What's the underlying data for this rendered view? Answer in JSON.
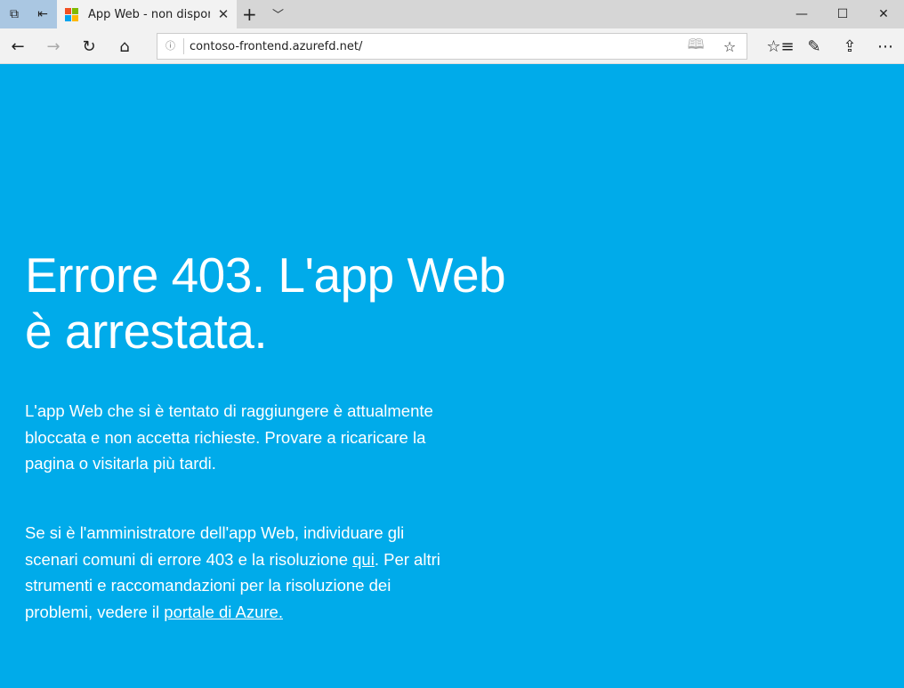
{
  "browser": {
    "tab_title": "App Web - non dispon",
    "url": "contoso-frontend.azurefd.net/",
    "brand_colors": [
      "#f25022",
      "#7fba00",
      "#00a4ef",
      "#ffb900"
    ]
  },
  "page": {
    "background": "#00abea",
    "heading_line1": "Errore 403. L'app Web",
    "heading_line2": "è arrestata.",
    "para1": "L'app Web che si è tentato di raggiungere è attualmente bloccata e non accetta richieste. Provare a ricaricare la pagina o visitarla più tardi.",
    "para2_a": "Se si è l'amministratore dell'app Web, individuare gli scenari comuni di errore 403 e la risoluzione ",
    "link_qui": "qui",
    "para2_b": ". Per altri strumenti e raccomandazioni per la risoluzione dei problemi, vedere il ",
    "link_portal": "portale di Azure."
  }
}
